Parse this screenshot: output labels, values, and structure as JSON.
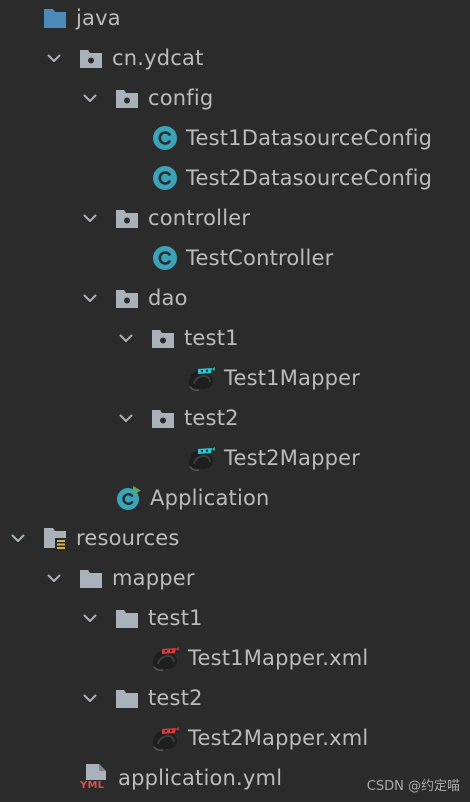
{
  "tree": {
    "java": "java",
    "cn_ydcat": "cn.ydcat",
    "config": "config",
    "test1_ds_config": "Test1DatasourceConfig",
    "test2_ds_config": "Test2DatasourceConfig",
    "controller": "controller",
    "test_controller": "TestController",
    "dao": "dao",
    "dao_test1": "test1",
    "test1_mapper": "Test1Mapper",
    "dao_test2": "test2",
    "test2_mapper": "Test2Mapper",
    "application": "Application",
    "resources": "resources",
    "mapper": "mapper",
    "mapper_test1": "test1",
    "test1_mapper_xml": "Test1Mapper.xml",
    "mapper_test2": "test2",
    "test2_mapper_xml": "Test2Mapper.xml",
    "application_yml": "application.yml",
    "yml_badge": "YML"
  },
  "watermark": "CSDN @约定喵",
  "icons": {
    "folder_blue": "folder-blue-icon",
    "package": "package-folder-icon",
    "folder": "folder-icon",
    "class": "class-icon",
    "mapper": "mybatis-mapper-icon",
    "mapper_xml": "mybatis-xml-icon",
    "resources": "resources-folder-icon",
    "yml": "yml-file-icon",
    "main_class": "main-class-icon"
  },
  "colors": {
    "background": "#2b2b2b",
    "text": "#bbbbbb",
    "folder_blue": "#4a8ab8",
    "folder_gray": "#a9b2ba",
    "class_circle": "#3ba4b8"
  }
}
